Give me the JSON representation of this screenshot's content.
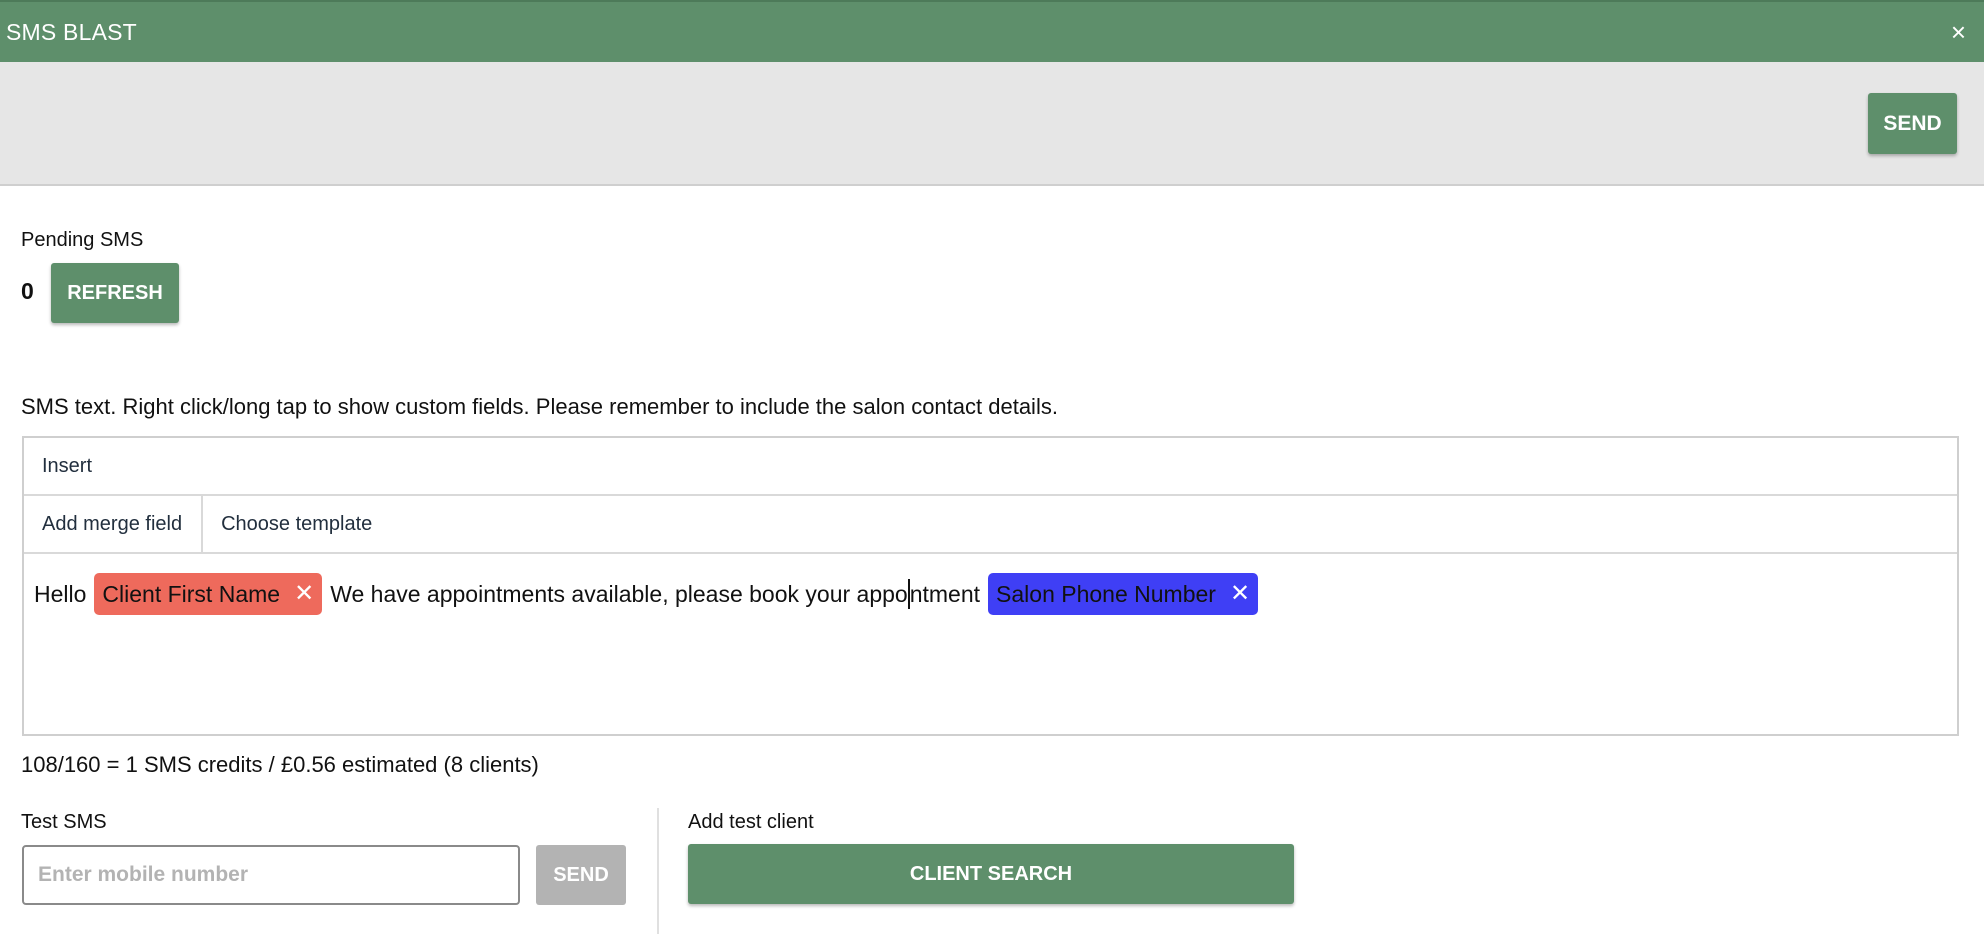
{
  "window": {
    "title": "SMS BLAST",
    "close_glyph": "×"
  },
  "toolbar": {
    "send_label": "SEND"
  },
  "pending": {
    "label": "Pending SMS",
    "count": "0",
    "refresh_label": "REFRESH"
  },
  "sms": {
    "instructions": "SMS text. Right click/long tap to show custom fields. Please remember to include the salon contact details.",
    "editor": {
      "menu_insert": "Insert",
      "toolbar_add_merge_field": "Add merge field",
      "toolbar_choose_template": "Choose template",
      "text_hello": "Hello",
      "chip_client_first_name": "Client First Name",
      "text_middle_before_caret": "We have appointments available, please book your appo",
      "text_middle_after_caret": "ntment",
      "chip_salon_phone": "Salon Phone Number",
      "chip_remove_glyph": "✕",
      "chip_colors": {
        "client_first_name": "#ee6a5c",
        "salon_phone": "#3f3ff5"
      }
    },
    "credits_text": "108/160 = 1 SMS credits / £0.56 estimated (8 clients)"
  },
  "test_sms": {
    "label": "Test SMS",
    "mobile_placeholder": "Enter mobile number",
    "send_label": "SEND"
  },
  "add_test_client": {
    "label": "Add test client",
    "client_search_label": "CLIENT SEARCH"
  },
  "colors": {
    "accent": "#5e8f6b",
    "toolbar_bg": "#e6e6e6",
    "disabled": "#b3b3b3"
  }
}
